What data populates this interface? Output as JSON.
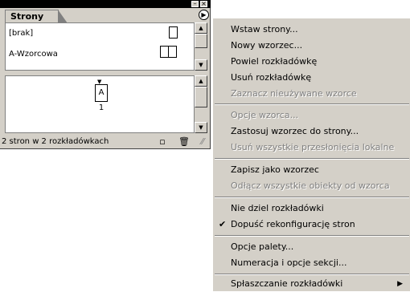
{
  "palette": {
    "tab_label": "Strony",
    "masters": [
      {
        "label": "[brak]"
      },
      {
        "label": "A-Wzorcowa"
      }
    ],
    "page": {
      "master_prefix": "A",
      "number": "1"
    },
    "status": "2 stron w 2 rozkładówkach",
    "icons": {
      "minimize": "minimize-icon",
      "close": "close-icon",
      "menu": "palette-menu-icon",
      "new_page": "new-page-icon",
      "delete": "trash-icon",
      "resize": "resize-grip-icon"
    }
  },
  "menu": {
    "items": [
      {
        "label": "Wstaw strony...",
        "enabled": true
      },
      {
        "label": "Nowy wzorzec...",
        "enabled": true
      },
      {
        "label": "Powiel rozkładówkę",
        "enabled": true
      },
      {
        "label": "Usuń rozkładówkę",
        "enabled": true
      },
      {
        "label": "Zaznacz nieużywane wzorce",
        "enabled": false
      },
      {
        "label": "Opcje wzorca...",
        "enabled": false
      },
      {
        "label": "Zastosuj wzorzec do strony...",
        "enabled": true
      },
      {
        "label": "Usuń wszystkie przesłonięcia lokalne",
        "enabled": false
      },
      {
        "label": "Zapisz jako wzorzec",
        "enabled": true
      },
      {
        "label": "Odłącz wszystkie obiekty od wzorca",
        "enabled": false
      },
      {
        "label": "Nie dziel rozkładówki",
        "enabled": true
      },
      {
        "label": "Dopuść rekonfigurację stron",
        "enabled": true,
        "checked": true
      },
      {
        "label": "Opcje palety...",
        "enabled": true
      },
      {
        "label": "Numeracja i opcje sekcji...",
        "enabled": true
      },
      {
        "label": "Spłaszczanie rozkładówki",
        "enabled": true,
        "submenu": true
      }
    ]
  },
  "colors": {
    "panel": "#d4d0c8",
    "disabled_text": "#808080"
  }
}
